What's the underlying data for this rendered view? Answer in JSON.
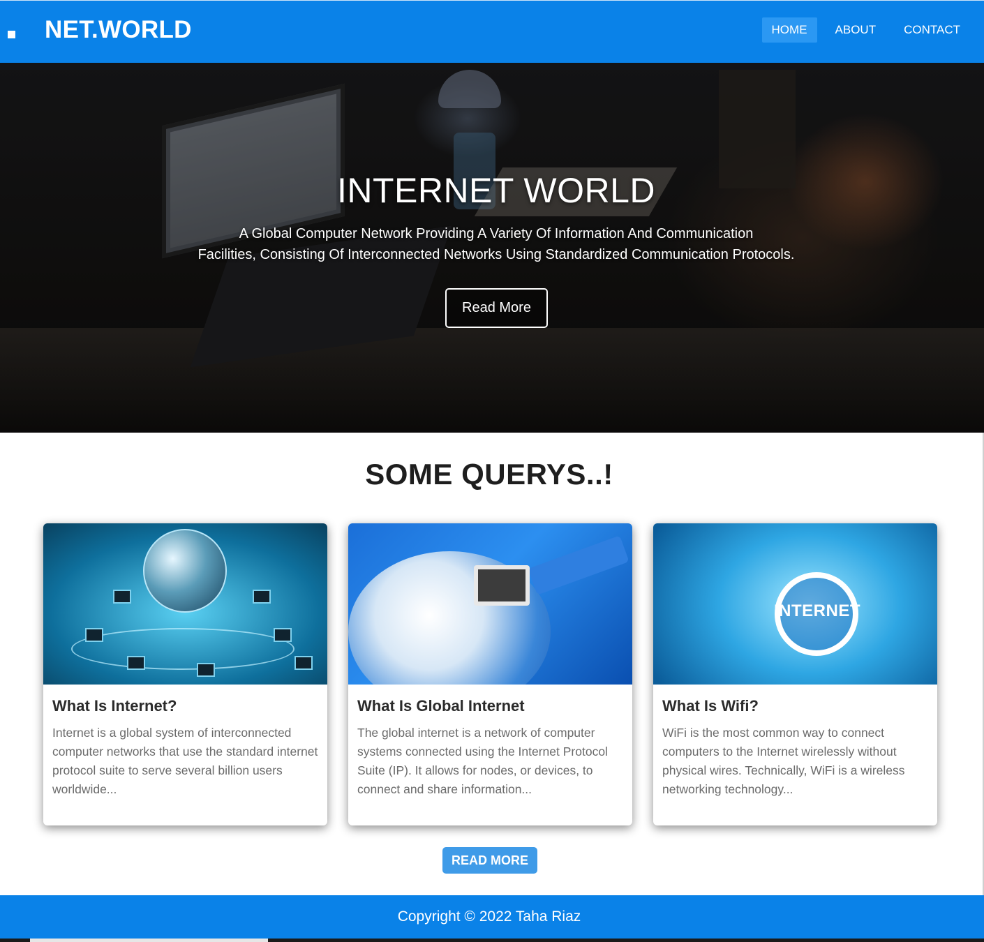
{
  "navbar": {
    "brand": "NET.WORLD",
    "links": [
      {
        "label": "HOME",
        "active": true
      },
      {
        "label": "ABOUT",
        "active": false
      },
      {
        "label": "CONTACT",
        "active": false
      }
    ],
    "color": "#0a82e8",
    "active_color": "#2b98f3"
  },
  "hero": {
    "title": "INTERNET WORLD",
    "text_line1": "A Global Computer Network Providing A Variety Of Information And Communication",
    "text_line2": "Facilities, Consisting Of Interconnected Networks Using Standardized Communication Protocols.",
    "button_label": "Read More"
  },
  "section": {
    "title": "SOME QUERYS..!",
    "cards": [
      {
        "title": "What Is Internet?",
        "text": "Internet is a global system of interconnected computer networks that use the standard internet protocol suite to serve several billion users worldwide..."
      },
      {
        "title": "What Is Global Internet",
        "text": "The global internet is a network of computer systems connected using the Internet Protocol Suite (IP). It allows for nodes, or devices, to connect and share information..."
      },
      {
        "title": "What Is Wifi?",
        "text": "WiFi is the most common way to connect computers to the Internet wirelessly without physical wires. Technically, WiFi is a wireless networking technology...",
        "image_label": "INTERNET"
      }
    ],
    "read_more_label": "READ MORE",
    "button_color": "#3f9be8"
  },
  "footer": {
    "text": "Copyright © 2022 Taha Riaz",
    "color": "#0a82e8"
  }
}
